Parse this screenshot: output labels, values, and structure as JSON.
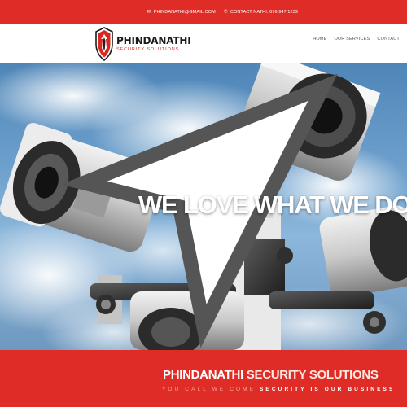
{
  "topbar": {
    "email": "PHINDANATHI@GMAIL.COM",
    "email_icon": "envelope-icon",
    "contact": "CONTACT NATHI: 076 947 1239",
    "contact_icon": "phone-icon",
    "color": "#e02c26"
  },
  "header": {
    "logo_name": "PHINDANATHI",
    "logo_sub": "SECURITY SOLUTIONS",
    "logo_icon": "shield-logo-icon"
  },
  "nav": {
    "items": [
      "HOME",
      "OUR SERVICES",
      "CONTACT"
    ]
  },
  "hero": {
    "title": "WE LOVE WHAT WE DO",
    "image": "cctv-cameras-sky-photo"
  },
  "band": {
    "title_part1": "PHINDANATHI",
    "title_part2": "SECURITY SOLUTIONS",
    "slogan_part1": "YOU CALL WE COME",
    "slogan_part2": "SECURITY IS OUR BUSINESS",
    "color": "#e02c26"
  }
}
